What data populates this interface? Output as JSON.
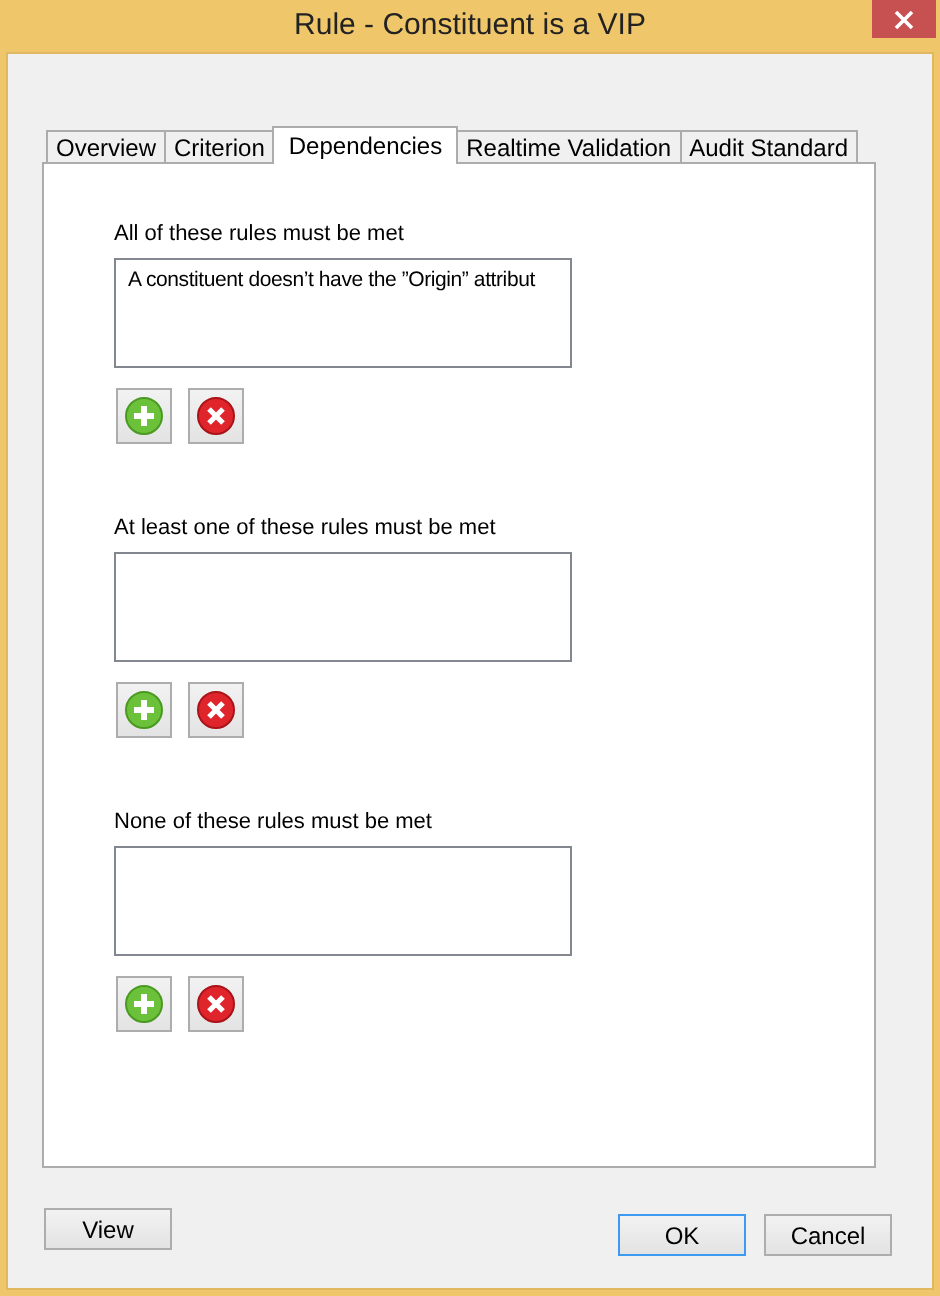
{
  "window": {
    "title": "Rule -  Constituent is a VIP"
  },
  "tabs": [
    {
      "label": "Overview",
      "selected": false
    },
    {
      "label": "Criterion",
      "selected": false
    },
    {
      "label": "Dependencies",
      "selected": true
    },
    {
      "label": "Realtime Validation",
      "selected": false
    },
    {
      "label": "Audit Standard",
      "selected": false
    }
  ],
  "sections": [
    {
      "label": "All of these rules must be met",
      "items": [
        "A constituent doesn’t have the ”Origin” attribut"
      ]
    },
    {
      "label": "At least one of these rules must be met"
    },
    {
      "label": "None of these rules must be met"
    }
  ],
  "footer": {
    "left": [
      {
        "label": "View",
        "focused": false
      }
    ],
    "right": [
      {
        "label": "OK",
        "focused": true
      },
      {
        "label": "Cancel",
        "focused": false
      }
    ]
  }
}
